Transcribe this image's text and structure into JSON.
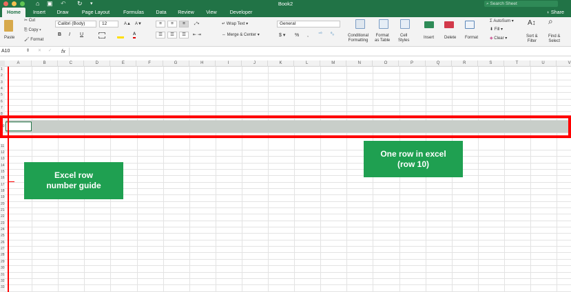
{
  "window": {
    "title": "Book2",
    "search_placeholder": "Search Sheet",
    "share_label": "Share"
  },
  "tabs": [
    "Home",
    "Insert",
    "Draw",
    "Page Layout",
    "Formulas",
    "Data",
    "Review",
    "View",
    "Developer"
  ],
  "clipboard": {
    "paste": "Paste",
    "cut": "Cut",
    "copy": "Copy",
    "format": "Format"
  },
  "font": {
    "name": "Calibri (Body)",
    "size": "12",
    "bold": "B",
    "italic": "I",
    "underline": "U"
  },
  "alignment": {
    "wrap_text": "Wrap Text",
    "merge_center": "Merge & Center"
  },
  "number": {
    "format": "General",
    "currency": "$",
    "percent": "%",
    "comma": ","
  },
  "styles": {
    "conditional": [
      "Conditional",
      "Formatting"
    ],
    "format_table": [
      "Format",
      "as Table"
    ],
    "cell_styles": [
      "Cell",
      "Styles"
    ]
  },
  "cells": {
    "insert": "Insert",
    "delete": "Delete",
    "format": "Format"
  },
  "editing": {
    "autosum": "AutoSum",
    "fill": "Fill",
    "clear": "Clear",
    "sort_filter": [
      "Sort &",
      "Filter"
    ],
    "find_select": [
      "Find &",
      "Select"
    ]
  },
  "formula_bar": {
    "name_box": "A10",
    "fx": "fx"
  },
  "columns": [
    "A",
    "B",
    "C",
    "D",
    "E",
    "F",
    "G",
    "H",
    "I",
    "J",
    "K",
    "L",
    "M",
    "N",
    "O",
    "P",
    "Q",
    "R",
    "S",
    "T",
    "U",
    "V"
  ],
  "rows": [
    "1",
    "2",
    "3",
    "4",
    "5",
    "6",
    "7",
    "8",
    "9",
    "10",
    "11",
    "12",
    "13",
    "14",
    "15",
    "16",
    "17",
    "18",
    "19",
    "20",
    "21",
    "22",
    "23",
    "24",
    "25",
    "26",
    "27",
    "28",
    "29",
    "30",
    "31",
    "32",
    "33",
    "34",
    "35"
  ],
  "callouts": {
    "row_guide": [
      "Excel row",
      "number guide"
    ],
    "one_row": [
      "One row in excel",
      "(row 10)"
    ]
  },
  "colors": {
    "excel_green": "#217346",
    "callout_green": "#1fa051",
    "highlight_red": "#ff0000",
    "row_fill": "#c8cec9"
  }
}
